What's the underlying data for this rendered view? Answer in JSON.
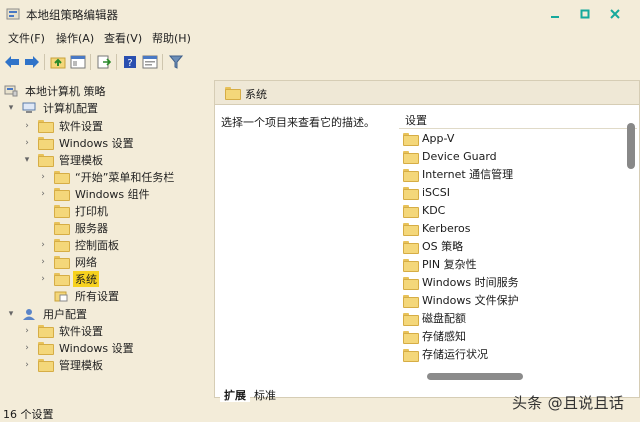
{
  "window": {
    "title": "本地组策略编辑器",
    "controls": [
      "minimize-icon",
      "maximize-icon",
      "close-icon"
    ],
    "accent": "#16a99c"
  },
  "menu": [
    "文件(F)",
    "操作(A)",
    "查看(V)",
    "帮助(H)"
  ],
  "toolbar": [
    "back-icon",
    "forward-icon",
    "up-folder-icon",
    "show-hide-tree-icon",
    "export-list-icon",
    "help-icon",
    "properties-icon",
    "filter-icon"
  ],
  "tree": {
    "root": "本地计算机 策略",
    "items": [
      {
        "label": "计算机配置",
        "level": 1
      },
      {
        "label": "软件设置",
        "level": 2
      },
      {
        "label": "Windows 设置",
        "level": 2
      },
      {
        "label": "管理模板",
        "level": 2
      },
      {
        "label": "“开始”菜单和任务栏",
        "level": 3
      },
      {
        "label": "Windows 组件",
        "level": 3
      },
      {
        "label": "打印机",
        "level": 3
      },
      {
        "label": "服务器",
        "level": 3
      },
      {
        "label": "控制面板",
        "level": 3
      },
      {
        "label": "网络",
        "level": 3
      },
      {
        "label": "系统",
        "level": 3,
        "selected": true
      },
      {
        "label": "所有设置",
        "level": 3
      },
      {
        "label": "用户配置",
        "level": 1
      },
      {
        "label": "软件设置",
        "level": 2
      },
      {
        "label": "Windows 设置",
        "level": 2
      },
      {
        "label": "管理模板",
        "level": 2
      }
    ]
  },
  "content": {
    "header": "系统",
    "description": "选择一个项目来查看它的描述。",
    "column": "设置",
    "rows": [
      "App-V",
      "Device Guard",
      "Internet 通信管理",
      "iSCSI",
      "KDC",
      "Kerberos",
      "OS 策略",
      "PIN 复杂性",
      "Windows 时间服务",
      "Windows 文件保护",
      "磁盘配额",
      "存储感知",
      "存储运行状况"
    ]
  },
  "tabs": [
    "扩展",
    "标准"
  ],
  "status": "16 个设置",
  "watermark": "头条 @且说且话"
}
